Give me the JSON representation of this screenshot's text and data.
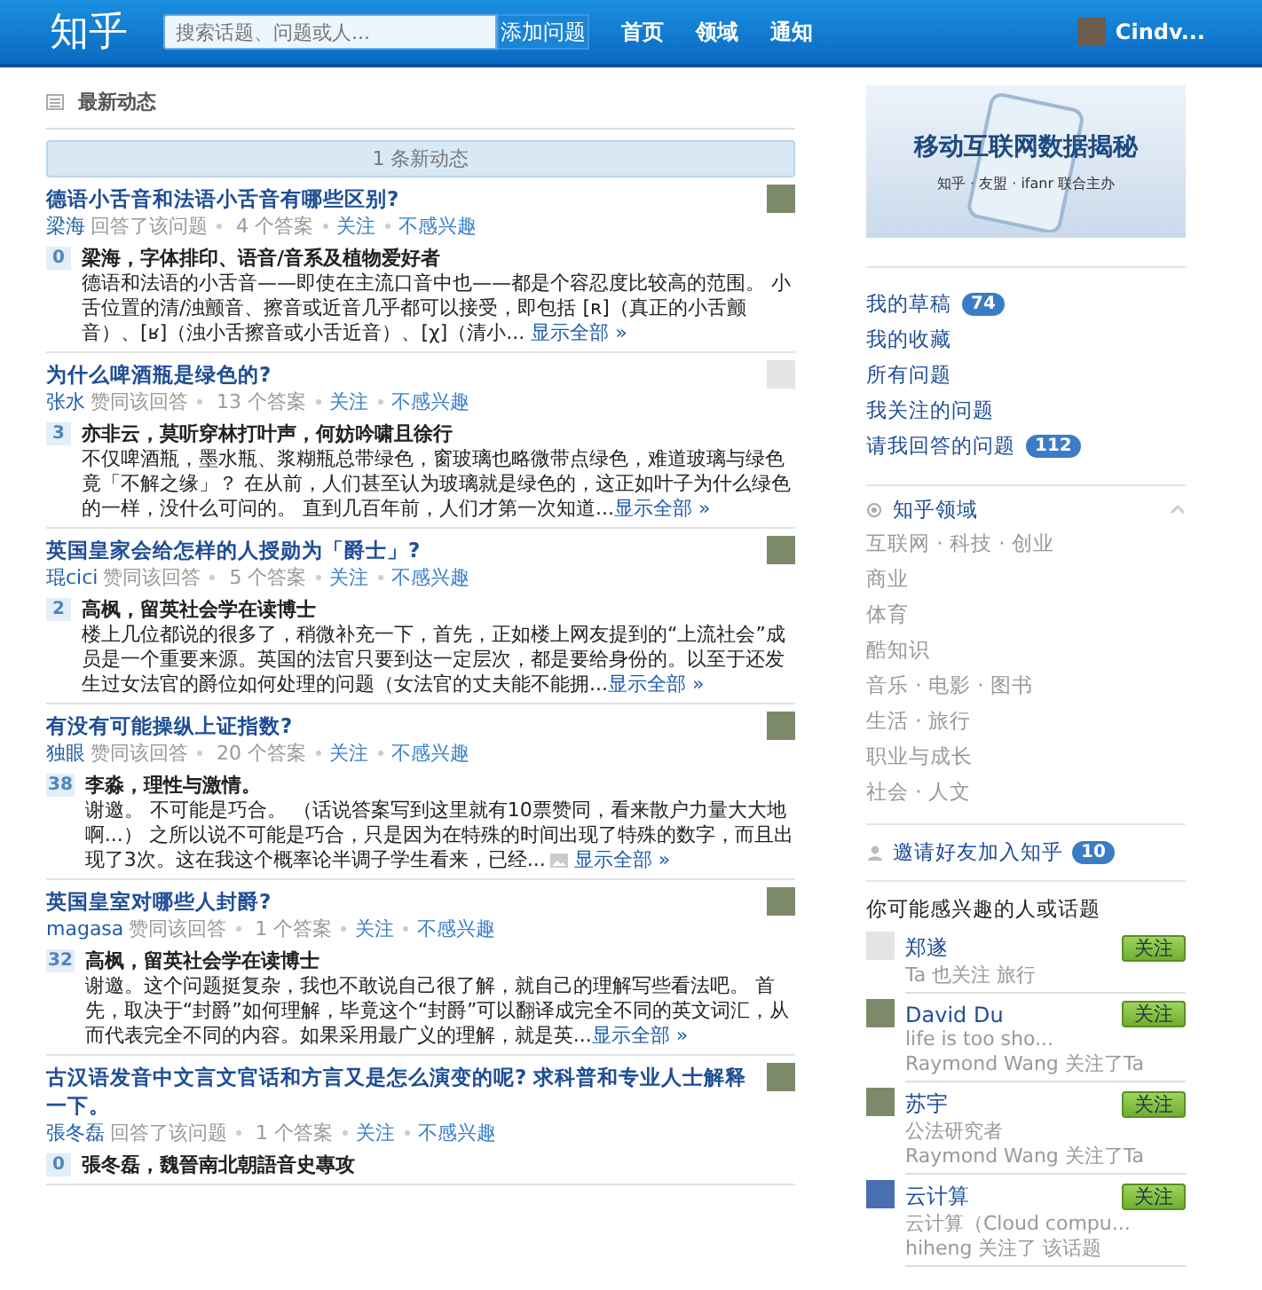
{
  "header": {
    "logo": "知乎",
    "search": {
      "placeholder": "搜索话题、问题或人..."
    },
    "add_button": "添加问题",
    "nav": [
      {
        "label": "首页"
      },
      {
        "label": "领域"
      },
      {
        "label": "通知"
      }
    ],
    "user": {
      "name": "Cindv..."
    }
  },
  "feed": {
    "title": "最新动态",
    "new_bar": "1 条新动态",
    "items": [
      {
        "question": "德语小舌音和法语小舌音有哪些区别?",
        "kind": "photo",
        "user": "梁海",
        "action": "回答了该问题",
        "answers": "4 个答案",
        "follow": "关注",
        "ignore": "不感兴趣",
        "votes": "0",
        "author": "梁海，字体排印、语音/音系及植物爱好者",
        "body": "德语和法语的小舌音——即使在主流口音中也——都是个容忍度比较高的范围。 小舌位置的清/浊颤音、擦音或近音几乎都可以接受，即包括 [ʀ]（真正的小舌颤音）、[ʁ]（浊小舌擦音或小舌近音）、[χ]（清小... ",
        "more": "显示全部 »",
        "image": false
      },
      {
        "question": "为什么啤酒瓶是绿色的?",
        "kind": "default",
        "user": "张水",
        "action": "赞同该回答",
        "answers": "13 个答案",
        "follow": "关注",
        "ignore": "不感兴趣",
        "votes": "3",
        "author": "亦非云，莫听穿林打叶声，何妨吟啸且徐行",
        "body": "不仅啤酒瓶，墨水瓶、浆糊瓶总带绿色，窗玻璃也略微带点绿色，难道玻璃与绿色竟「不解之缘」？ 在从前，人们甚至认为玻璃就是绿色的，这正如叶子为什么绿色的一样，没什么可问的。 直到几百年前，人们才第一次知道...",
        "more": "显示全部 »",
        "image": false
      },
      {
        "question": "英国皇家会给怎样的人授勋为「爵士」?",
        "kind": "photo",
        "user": "琨cici",
        "action": "赞同该回答",
        "answers": "5 个答案",
        "follow": "关注",
        "ignore": "不感兴趣",
        "votes": "2",
        "author": "高枫，留英社会学在读博士",
        "body": "楼上几位都说的很多了，稍微补充一下，首先，正如楼上网友提到的“上流社会”成员是一个重要来源。英国的法官只要到达一定层次，都是要给身份的。以至于还发生过女法官的爵位如何处理的问题（女法官的丈夫能不能拥...",
        "more": "显示全部 »",
        "image": false
      },
      {
        "question": "有没有可能操纵上证指数?",
        "kind": "photo",
        "user": "独眼",
        "action": "赞同该回答",
        "answers": "20 个答案",
        "follow": "关注",
        "ignore": "不感兴趣",
        "votes": "38",
        "author": "李淼，理性与激情。",
        "body": "谢邀。 不可能是巧合。 （话说答案写到这里就有10票赞同，看来散户力量大大地啊...） 之所以说不可能是巧合，只是因为在特殊的时间出现了特殊的数字，而且出现了3次。这在我这个概率论半调子学生看来，已经...",
        "more": "显示全部 »",
        "image": true
      },
      {
        "question": "英国皇室对哪些人封爵?",
        "kind": "photo",
        "user": "magasa",
        "action": "赞同该回答",
        "answers": "1 个答案",
        "follow": "关注",
        "ignore": "不感兴趣",
        "votes": "32",
        "author": "高枫，留英社会学在读博士",
        "body": "谢邀。这个问题挺复杂，我也不敢说自己很了解，就自己的理解写些看法吧。 首先，取决于“封爵”如何理解，毕竟这个“封爵”可以翻译成完全不同的英文词汇，从而代表完全不同的内容。如果采用最广义的理解，就是英...",
        "more": "显示全部 »",
        "image": false
      },
      {
        "question": "古汉语发音中文言文官话和方言又是怎么演变的呢? 求科普和专业人士解释一下。",
        "kind": "photo",
        "user": "張冬磊",
        "action": "回答了该问题",
        "answers": "1 个答案",
        "follow": "关注",
        "ignore": "不感兴趣",
        "votes": "0",
        "author": "張冬磊，魏晉南北朝語音史專攻"
      }
    ]
  },
  "sidebar": {
    "banner": {
      "title": "移动互联网数据揭秘",
      "subtitle": "知乎 · 友盟 · ifanr  联合主办"
    },
    "links": [
      {
        "label": "我的草稿",
        "count": "74"
      },
      {
        "label": "我的收藏"
      },
      {
        "label": "所有问题"
      },
      {
        "label": "我关注的问题"
      },
      {
        "label": "请我回答的问题",
        "count": "112"
      }
    ],
    "domains": {
      "title": "知乎领域",
      "expanded": true,
      "items": [
        "互联网 · 科技 · 创业",
        "商业",
        "体育",
        "酷知识",
        "音乐 · 电影 · 图书",
        "生活 · 旅行",
        "职业与成长",
        "社会 · 人文"
      ]
    },
    "invite": {
      "label": "邀请好友加入知乎",
      "count": "10"
    },
    "suggest": {
      "title": "你可能感兴趣的人或话题",
      "items": [
        {
          "name": "郑遂",
          "kind": "default",
          "lines": [
            "Ta 也关注 旅行"
          ],
          "button": "关注"
        },
        {
          "name": "David Du",
          "kind": "photo",
          "lines": [
            "life is too sho...",
            "Raymond Wang 关注了Ta"
          ],
          "button": "关注"
        },
        {
          "name": "苏宇",
          "kind": "photo",
          "lines": [
            "公法研究者",
            "Raymond Wang 关注了Ta"
          ],
          "button": "关注"
        },
        {
          "name": "云计算",
          "kind": "topic",
          "lines": [
            "云计算（Cloud compu...",
            "hiheng 关注了 该话题"
          ],
          "button": "关注"
        }
      ]
    }
  }
}
